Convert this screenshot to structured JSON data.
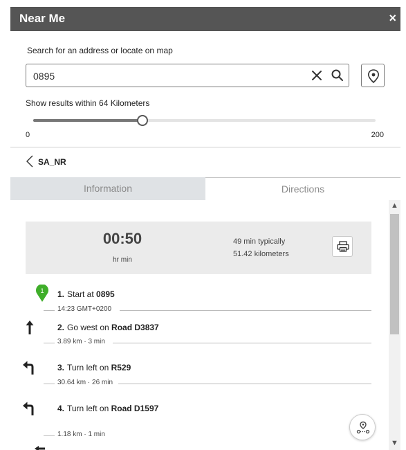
{
  "header": {
    "title": "Near Me",
    "close_label": "×"
  },
  "search": {
    "label": "Search for an address or locate on map",
    "value": "0895"
  },
  "radius": {
    "label": "Show results within 64 Kilometers",
    "value": 64,
    "min": "0",
    "max": "200"
  },
  "back": {
    "label": "SA_NR"
  },
  "tabs": {
    "information": "Information",
    "directions": "Directions"
  },
  "summary": {
    "time": "00:50",
    "units": "hr  min",
    "typically": "49 min typically",
    "distance": "51.42 kilometers"
  },
  "steps": [
    {
      "num": "1.",
      "text": "Start at ",
      "bold": "0895",
      "meta": "14:23 GMT+0200",
      "icon": "start-pin-icon",
      "marker": "1"
    },
    {
      "num": "2.",
      "text": "Go west on ",
      "bold": "Road D3837",
      "meta": "3.89 km · 3 min",
      "icon": "arrow-straight-icon"
    },
    {
      "num": "3.",
      "text": "Turn left on ",
      "bold": "R529",
      "meta": "30.64 km · 26 min",
      "icon": "turn-left-icon"
    },
    {
      "num": "4.",
      "text": "Turn left on ",
      "bold": "Road D1597",
      "meta": "1.18 km · 1 min",
      "icon": "turn-left-icon"
    }
  ],
  "colors": {
    "header_bg": "#555555",
    "pin_green": "#3fae2a",
    "tab_inactive_bg": "#dfe2e5"
  }
}
